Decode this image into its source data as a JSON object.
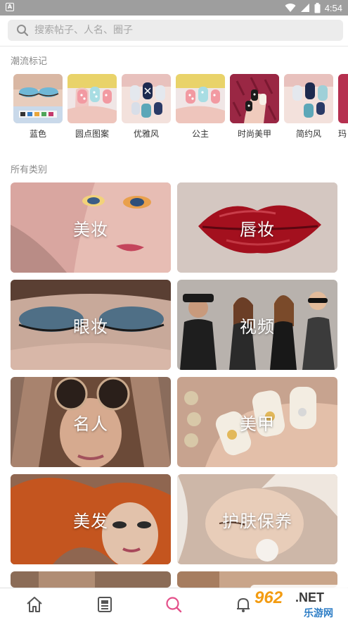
{
  "status_bar": {
    "notification_badge": "A",
    "time": "4:54"
  },
  "search": {
    "placeholder": "搜索帖子、人名、圈子"
  },
  "trending": {
    "title": "潮流标记",
    "items": [
      {
        "label": "蓝色"
      },
      {
        "label": "圆点图案"
      },
      {
        "label": "优雅风"
      },
      {
        "label": "公主"
      },
      {
        "label": "时尚美甲"
      },
      {
        "label": "简约风"
      },
      {
        "label": "玛"
      }
    ]
  },
  "categories": {
    "title": "所有类别",
    "items": [
      {
        "label": "美妆"
      },
      {
        "label": "唇妆"
      },
      {
        "label": "眼妆"
      },
      {
        "label": "视频"
      },
      {
        "label": "名人"
      },
      {
        "label": "美甲"
      },
      {
        "label": "美发"
      },
      {
        "label": "护肤保养"
      }
    ]
  },
  "watermark": {
    "number": "962",
    "suffix": ".NET",
    "site": "乐游网"
  },
  "colors": {
    "accent": "#e4508a",
    "tab_inactive": "#555555"
  }
}
